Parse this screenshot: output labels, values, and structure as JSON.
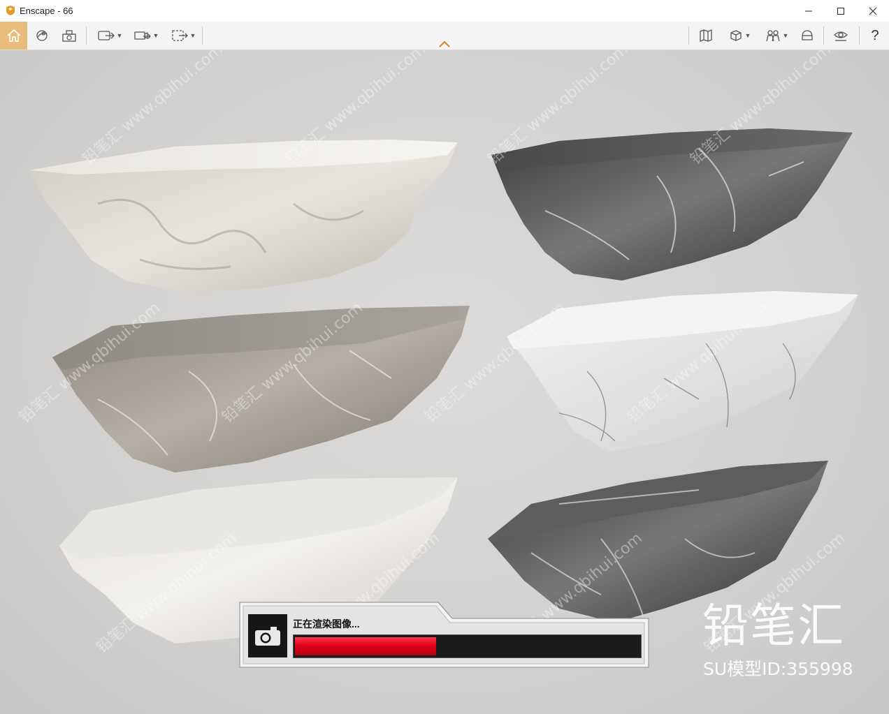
{
  "window": {
    "title": "Enscape - 66"
  },
  "toolbar": {
    "left_buttons": [
      "home-icon",
      "orbit-icon",
      "screenshot-settings-icon",
      "export-image-icon",
      "export-video-icon",
      "batch-render-icon"
    ],
    "right_buttons": [
      "map-icon",
      "view-mode-icon",
      "people-icon",
      "helmet-icon",
      "visibility-icon"
    ],
    "help_label": "?"
  },
  "viewport": {
    "brand_watermark": "铅笔汇",
    "model_id": "SU模型ID:355998",
    "tile_watermark": "铅笔汇 www.qbihui.com"
  },
  "render": {
    "status_label": "正在渲染图像...",
    "progress": 0.41,
    "colors": {
      "fill": "#e0001a",
      "track": "#1b1b1b"
    }
  }
}
